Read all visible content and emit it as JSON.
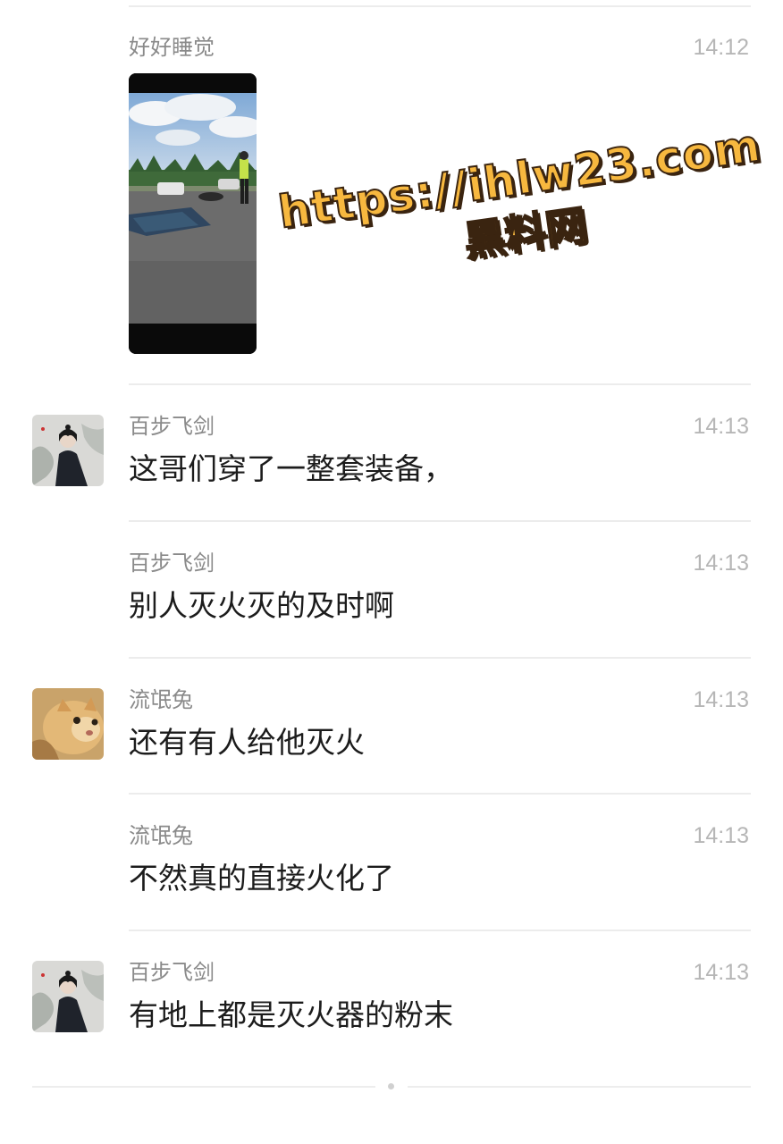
{
  "messages": [
    {
      "sender": "好好睡觉",
      "time": "14:12",
      "type": "video"
    },
    {
      "sender": "百步飞剑",
      "time": "14:13",
      "text": "这哥们穿了一整套装备，",
      "avatar": "swordsman-avatar"
    },
    {
      "sender": "百步飞剑",
      "time": "14:13",
      "text": "别人灭火灭的及时啊"
    },
    {
      "sender": "流氓兔",
      "time": "14:13",
      "text": "还有有人给他灭火",
      "avatar": "cat-avatar"
    },
    {
      "sender": "流氓兔",
      "time": "14:13",
      "text": "不然真的直接火化了"
    },
    {
      "sender": "百步飞剑",
      "time": "14:13",
      "text": "有地上都是灭火器的粉末",
      "avatar": "swordsman-avatar"
    }
  ],
  "watermark": {
    "url": "https://ihlw23.com",
    "name": "黑料网"
  },
  "colors": {
    "watermark_fill": "#f7b83f",
    "watermark_stroke": "#3a2410"
  }
}
